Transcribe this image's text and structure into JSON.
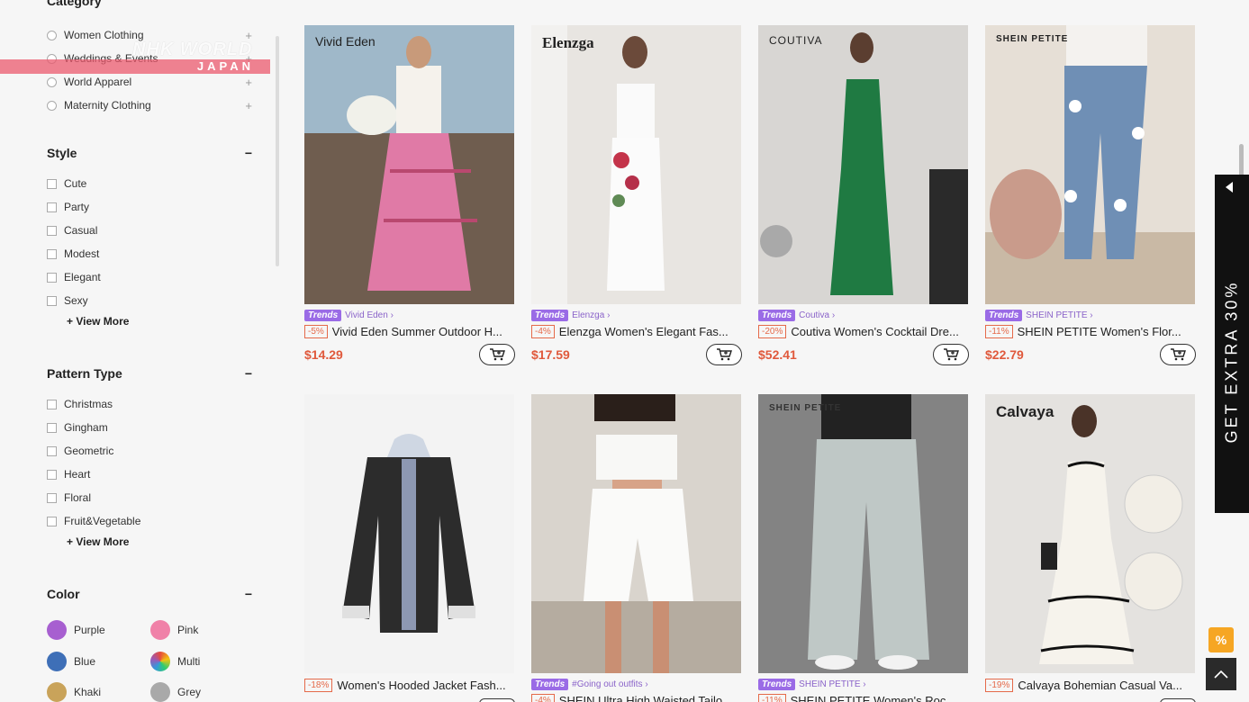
{
  "logo": {
    "word": "NHK WORLD",
    "japan": "JAPAN"
  },
  "sidebar": {
    "category_title": "Category",
    "categories": [
      "Women Clothing",
      "Weddings & Events",
      "World Apparel",
      "Maternity Clothing"
    ],
    "style": {
      "title": "Style",
      "options": [
        "Cute",
        "Party",
        "Casual",
        "Modest",
        "Elegant",
        "Sexy"
      ],
      "view_more": "+ View More"
    },
    "pattern": {
      "title": "Pattern Type",
      "options": [
        "Christmas",
        "Gingham",
        "Geometric",
        "Heart",
        "Floral",
        "Fruit&Vegetable"
      ],
      "view_more": "+ View More"
    },
    "color": {
      "title": "Color",
      "items": [
        {
          "name": "Purple",
          "hex": "#a75fd0"
        },
        {
          "name": "Pink",
          "hex": "#f081a8"
        },
        {
          "name": "Blue",
          "hex": "#3e6fb7"
        },
        {
          "name": "Multi",
          "hex": "multi"
        },
        {
          "name": "Khaki",
          "hex": "#c9a35a"
        },
        {
          "name": "Grey",
          "hex": "#a9a9a9"
        }
      ]
    },
    "collapse_symbol": "−",
    "expand_symbol": "+"
  },
  "products": [
    {
      "brand_mark": "Vivid Eden",
      "trend": "Trends",
      "store": "Vivid Eden ›",
      "discount": "-5%",
      "title": "Vivid Eden Summer Outdoor H...",
      "price": "$14.29"
    },
    {
      "brand_mark": "Elenzga",
      "trend": "Trends",
      "store": "Elenzga ›",
      "discount": "-4%",
      "title": "Elenzga Women's Elegant Fas...",
      "price": "$17.59"
    },
    {
      "brand_mark": "COUTIVA",
      "trend": "Trends",
      "store": "Coutiva ›",
      "discount": "-20%",
      "title": "Coutiva Women's Cocktail Dre...",
      "price": "$52.41"
    },
    {
      "brand_mark": "SHEIN PETITE",
      "trend": "Trends",
      "store": "SHEIN PETITE ›",
      "discount": "-11%",
      "title": "SHEIN PETITE Women's Flor...",
      "price": "$22.79"
    },
    {
      "brand_mark": "",
      "trend": "",
      "store": "",
      "discount": "-18%",
      "title": "Women's Hooded Jacket Fash...",
      "price": ""
    },
    {
      "brand_mark": "",
      "trend": "Trends",
      "store": "#Going out outfits ›",
      "discount": "-4%",
      "title": "SHEIN Ultra High Waisted Tailo...",
      "price": ""
    },
    {
      "brand_mark": "SHEIN PETITE",
      "trend": "Trends",
      "store": "SHEIN PETITE ›",
      "discount": "-11%",
      "title": "SHEIN PETITE Women's Roc...",
      "price": ""
    },
    {
      "brand_mark": "Calvaya",
      "trend": "",
      "store": "",
      "discount": "-19%",
      "title": "Calvaya Bohemian Casual Va...",
      "price": ""
    }
  ],
  "promo": {
    "text": "GET EXTRA 30%",
    "coupon_icon": "%"
  }
}
